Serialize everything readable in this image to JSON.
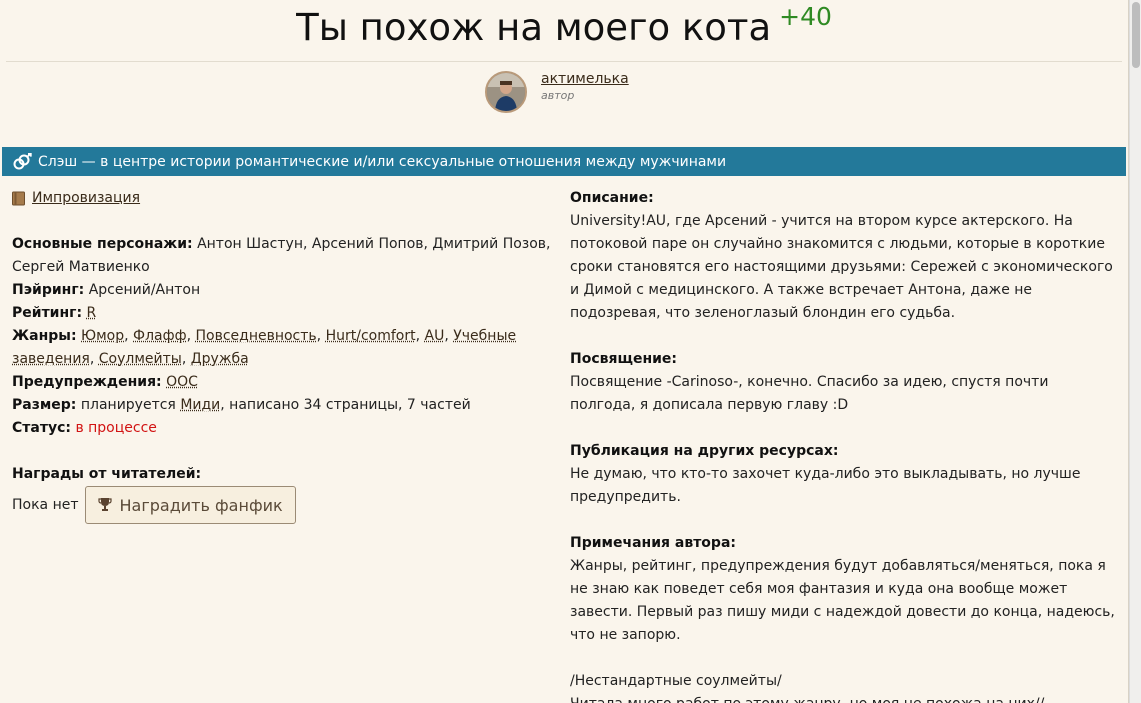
{
  "header": {
    "title": "Ты похож на моего кота",
    "likes": "+40"
  },
  "author": {
    "name": "актимелька",
    "role": "автор"
  },
  "direction_banner": {
    "icon": "slash-icon",
    "text": "Слэш — в центре истории романтические и/или сексуальные отношения между мужчинами"
  },
  "info": {
    "fandom": "Импровизация",
    "characters_label": "Основные персонажи:",
    "characters": "Антон Шастун, Арсений Попов, Дмитрий Позов, Сергей Матвиенко",
    "pairing_label": "Пэйринг:",
    "pairing": "Арсений/Антон",
    "rating_label": "Рейтинг:",
    "rating": "R",
    "genres_label": "Жанры:",
    "genres": [
      "Юмор",
      "Флафф",
      "Повседневность",
      "Hurt/comfort",
      "AU",
      "Учебные заведения",
      "Соулмейты",
      "Дружба"
    ],
    "warnings_label": "Предупреждения:",
    "warnings": "ООС",
    "size_label": "Размер:",
    "size_pre": "планируется",
    "size_link": "Миди",
    "size_post": ", написано 34 страницы, 7 частей",
    "status_label": "Статус:",
    "status": "в процессе",
    "status_color": "#d21313"
  },
  "awards": {
    "label": "Награды от читателей:",
    "none_text": "Пока нет",
    "button_label": "Наградить фанфик",
    "button_icon": "trophy-icon"
  },
  "right": {
    "description_label": "Описание:",
    "description": "University!AU, где Арсений - учится на втором курсе актерского. На потоковой паре он случайно знакомится с людьми, которые в короткие сроки становятся его настоящими друзьями: Сережей с экономического и Димой с медицинского. А также встречает Антона, даже не подозревая, что зеленоглазый блондин его судьба.",
    "dedication_label": "Посвящение:",
    "dedication": "Посвящение -Carinoso-, конечно. Спасибо за идею, спустя почти полгода, я дописала первую главу :D",
    "publication_label": "Публикация на других ресурсах:",
    "publication": "Не думаю, что кто-то захочет куда-либо это выкладывать, но лучше предупредить.",
    "notes_label": "Примечания автора:",
    "notes": "Жанры, рейтинг, предупреждения будут добавляться/меняться, пока я не знаю как поведет себя моя фантазия и куда она вообще может завести. Первый раз пишу миди с надеждой довести до конца, надеюсь, что не запорю.",
    "notes_extra_1": "/Нестандартные соулмейты/",
    "notes_extra_2": "Читала много работ по этому жанру, но моя не похожа на них//"
  },
  "colors": {
    "background": "#faf5ec",
    "banner": "#23799a",
    "likes": "#2f8a23",
    "link": "#3a2b1a"
  }
}
